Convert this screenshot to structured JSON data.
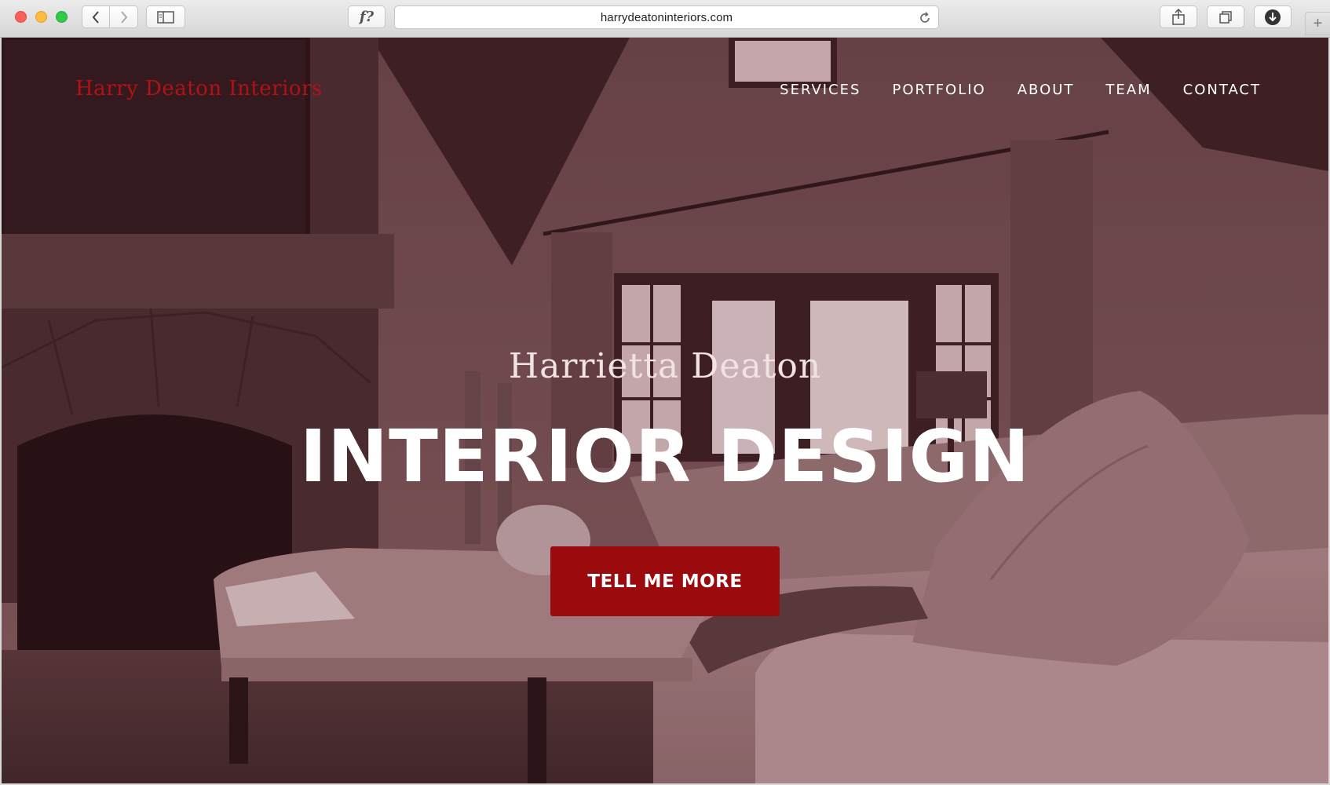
{
  "browser": {
    "url": "harrydeatoninteriors.com",
    "read_later_label": "f?",
    "new_tab_label": "+"
  },
  "site": {
    "brand": "Harry Deaton Interiors",
    "nav": [
      {
        "label": "SERVICES"
      },
      {
        "label": "PORTFOLIO"
      },
      {
        "label": "ABOUT"
      },
      {
        "label": "TEAM"
      },
      {
        "label": "CONTACT"
      }
    ]
  },
  "hero": {
    "subtitle": "Harrietta Deaton",
    "title": "INTERIOR DESIGN",
    "cta_label": "TELL ME MORE",
    "image_subject": "living room with stone fireplace, tufted ottoman, sectional sofa and windows"
  },
  "colors": {
    "brand_red": "#b01218",
    "cta_red": "#9b0a0d",
    "overlay_tint": "#5a3a3e"
  },
  "icons": [
    "back-icon",
    "forward-icon",
    "sidebar-icon",
    "reload-icon",
    "share-icon",
    "tabs-icon",
    "download-icon"
  ]
}
